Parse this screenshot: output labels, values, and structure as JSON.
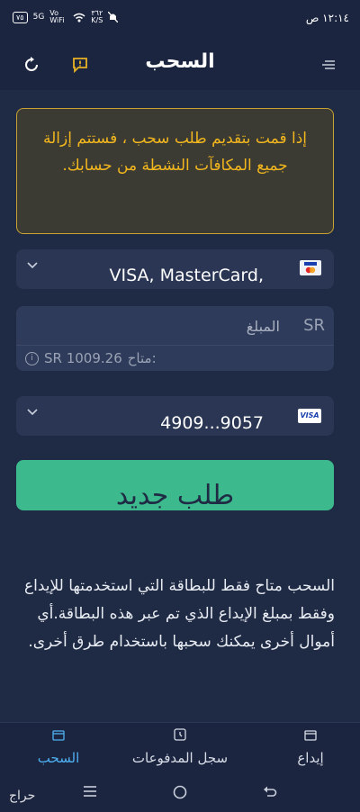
{
  "status_bar": {
    "time": "١٢:١٤ ص",
    "battery": "٧٥",
    "network": "5G",
    "volte": "Vo WiFi",
    "speed_value": "٣٦٢",
    "speed_unit": "K/S"
  },
  "app_bar": {
    "title": "السحب",
    "menu_icon": "menu-icon",
    "report_icon": "report-icon",
    "refresh_icon": "refresh-icon"
  },
  "warning": {
    "text": "إذا قمت بتقديم طلب سحب ، فستتم إزالة جميع المكافآت النشطة من حسابك.",
    "color": "#f2b61e"
  },
  "method_select": {
    "value": "VISA, MasterCard,"
  },
  "amount": {
    "currency": "SR",
    "placeholder": "المبلغ",
    "available_label": "متاح:",
    "available_value": "SR 1009.26"
  },
  "card_select": {
    "value": "4909...9057",
    "brand": "VISA"
  },
  "submit_label": "طلب جديد",
  "note": "السحب متاح فقط للبطاقة التي استخدمتها للإيداع وفقط بمبلغ الإيداع الذي تم عبر هذه البطاقة.أي أموال أخرى يمكنك سحبها باستخدام طرق أخرى.",
  "bottom_nav": [
    {
      "label": "إيداع",
      "icon": "deposit-icon",
      "active": false
    },
    {
      "label": "سجل المدفوعات",
      "icon": "clock-icon",
      "active": false
    },
    {
      "label": "السحب",
      "icon": "withdraw-icon",
      "active": true
    }
  ],
  "accent_color": "#3dba8d",
  "active_nav_color": "#4fb1f2",
  "watermark": "حراج"
}
